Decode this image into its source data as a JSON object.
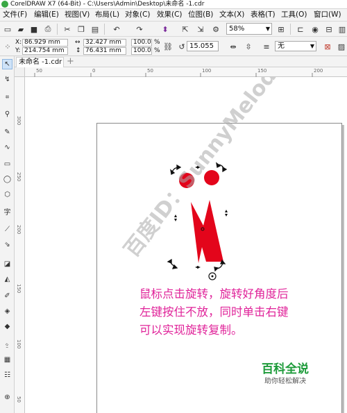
{
  "window": {
    "title": "CorelDRAW X7 (64-Bit) - C:\\Users\\Admin\\Desktop\\未命名 -1.cdr"
  },
  "menu": [
    {
      "label": "文件(F)"
    },
    {
      "label": "编辑(E)"
    },
    {
      "label": "视图(V)"
    },
    {
      "label": "布局(L)"
    },
    {
      "label": "对象(C)"
    },
    {
      "label": "效果(C)"
    },
    {
      "label": "位图(B)"
    },
    {
      "label": "文本(X)"
    },
    {
      "label": "表格(T)"
    },
    {
      "label": "工具(O)"
    },
    {
      "label": "窗口(W)"
    }
  ],
  "toolbar": {
    "zoom": "58%"
  },
  "properties": {
    "x_label": "X:",
    "x_value": "86.929 mm",
    "y_label": "Y:",
    "y_value": "214.754 mm",
    "width_value": "32.427 mm",
    "height_value": "76.431 mm",
    "scale_w": "100.0",
    "scale_h": "100.0",
    "percent": "%",
    "angle": "15.055",
    "outline": "无"
  },
  "document_tab": {
    "label": "未命名 -1.cdr"
  },
  "ruler": {
    "h_ticks": [
      "50",
      "0",
      "50",
      "100",
      "150",
      "200"
    ],
    "v_ticks": [
      "300",
      "250",
      "200",
      "150",
      "100",
      "50"
    ]
  },
  "canvas": {
    "instruction_lines": [
      "鼠标点击旋转，旋转好角度后",
      "左键按住不放，同时单击右键",
      "可以实现旋转复制。"
    ],
    "watermark": "百度ID：SunnyMelody夏",
    "brand_title": "百科全说",
    "brand_subtitle": "助你轻松解决"
  },
  "colors": {
    "shape_fill": "#e3051b",
    "instruction": "#e0249a",
    "brand": "#1d9b3a"
  }
}
